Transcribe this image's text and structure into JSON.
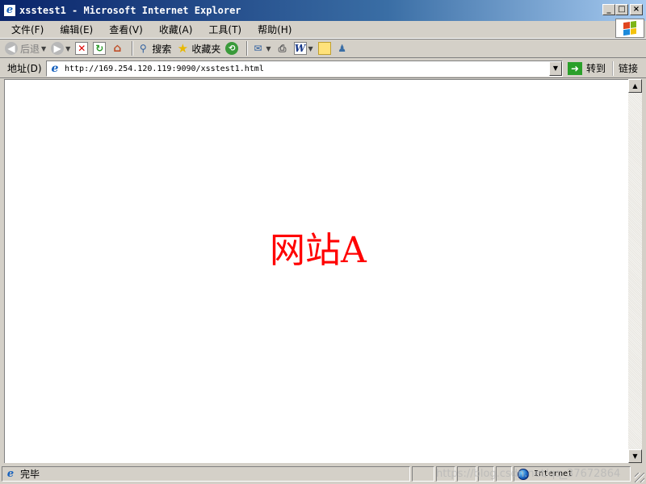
{
  "window": {
    "title": "xsstest1 - Microsoft Internet Explorer",
    "minimize": "_",
    "maximize": "□",
    "close": "×"
  },
  "menu": [
    "文件(F)",
    "编辑(E)",
    "查看(V)",
    "收藏(A)",
    "工具(T)",
    "帮助(H)"
  ],
  "toolbar": {
    "back_label": "后退",
    "search_label": "搜索",
    "favorites_label": "收藏夹"
  },
  "address": {
    "label": "地址(D)",
    "url": "http://169.254.120.119:9090/xsstest1.html",
    "go_label": "转到",
    "links_label": "链接"
  },
  "content": {
    "text": "网站A",
    "text_color": "#ff0000"
  },
  "status": {
    "text": "完毕",
    "zone": "Internet",
    "watermark": "https://blog.csdn.net/qq_37672864"
  },
  "icons": {
    "back": "back-arrow-icon",
    "forward": "forward-arrow-icon",
    "stop": "stop-icon",
    "refresh": "refresh-icon",
    "home": "home-icon",
    "search": "search-icon",
    "favorites": "star-icon",
    "history": "history-icon",
    "mail": "mail-icon",
    "print": "print-icon",
    "edit": "edit-icon",
    "discuss": "discuss-icon",
    "messenger": "messenger-icon"
  }
}
